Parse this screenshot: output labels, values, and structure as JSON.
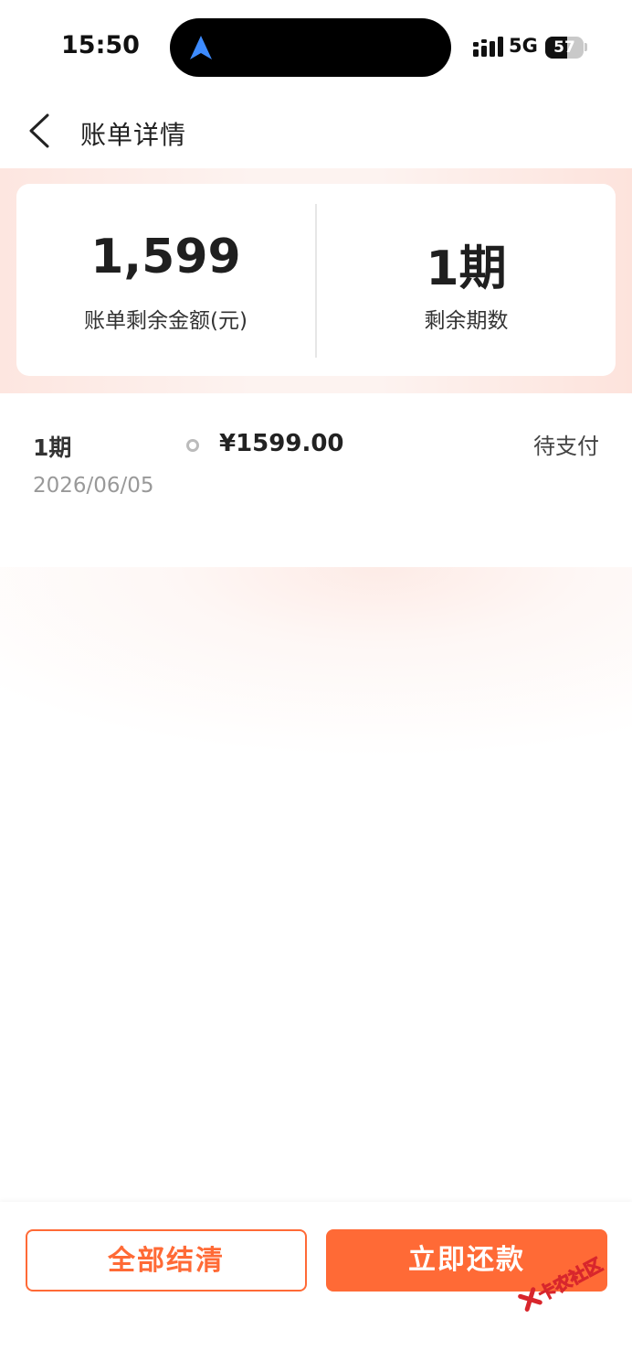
{
  "status_bar": {
    "time": "15:50",
    "network": "5G",
    "battery_level": "57",
    "battery_fraction": 0.57
  },
  "header": {
    "title": "账单详情",
    "back_icon": "chevron-left-icon"
  },
  "summary": {
    "remaining_amount": "1,599",
    "remaining_amount_label": "账单剩余金额(元)",
    "remaining_periods": "1期",
    "remaining_periods_label": "剩余期数"
  },
  "bills": [
    {
      "period": "1期",
      "date": "2026/06/05",
      "amount": "¥1599.00",
      "status": "待支付"
    }
  ],
  "footer": {
    "settle_all_label": "全部结清",
    "repay_now_label": "立即还款"
  },
  "watermark": {
    "text": "卡农社区"
  },
  "colors": {
    "accent": "#ff6a36",
    "text_primary": "#222222",
    "text_muted": "#999999"
  }
}
